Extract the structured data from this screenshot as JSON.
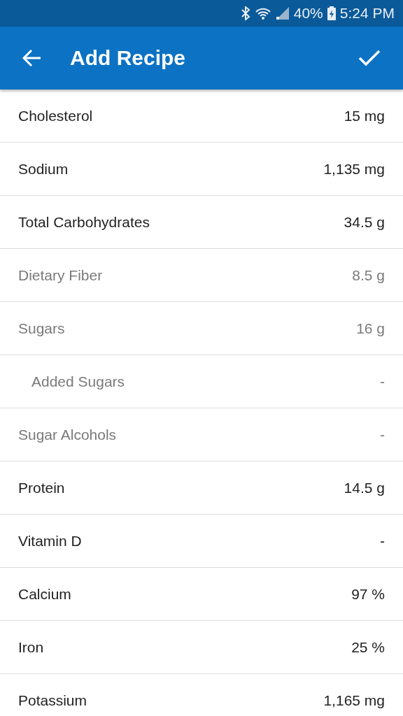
{
  "status_bar": {
    "battery": "40%",
    "time": "5:24 PM"
  },
  "app_bar": {
    "title": "Add Recipe"
  },
  "rows": [
    {
      "kind": "main",
      "label": "Cholesterol",
      "value": "15 mg"
    },
    {
      "kind": "main",
      "label": "Sodium",
      "value": "1,135 mg"
    },
    {
      "kind": "main",
      "label": "Total Carbohydrates",
      "value": "34.5 g"
    },
    {
      "kind": "sub",
      "label": "Dietary Fiber",
      "value": "8.5 g"
    },
    {
      "kind": "sub",
      "label": "Sugars",
      "value": "16 g"
    },
    {
      "kind": "subsub",
      "label": "Added Sugars",
      "value": "-"
    },
    {
      "kind": "sub",
      "label": "Sugar Alcohols",
      "value": "-"
    },
    {
      "kind": "main",
      "label": "Protein",
      "value": "14.5 g"
    },
    {
      "kind": "main",
      "label": "Vitamin D",
      "value": "-"
    },
    {
      "kind": "main",
      "label": "Calcium",
      "value": "97 %"
    },
    {
      "kind": "main",
      "label": "Iron",
      "value": "25 %"
    },
    {
      "kind": "main",
      "label": "Potassium",
      "value": "1,165 mg"
    }
  ]
}
